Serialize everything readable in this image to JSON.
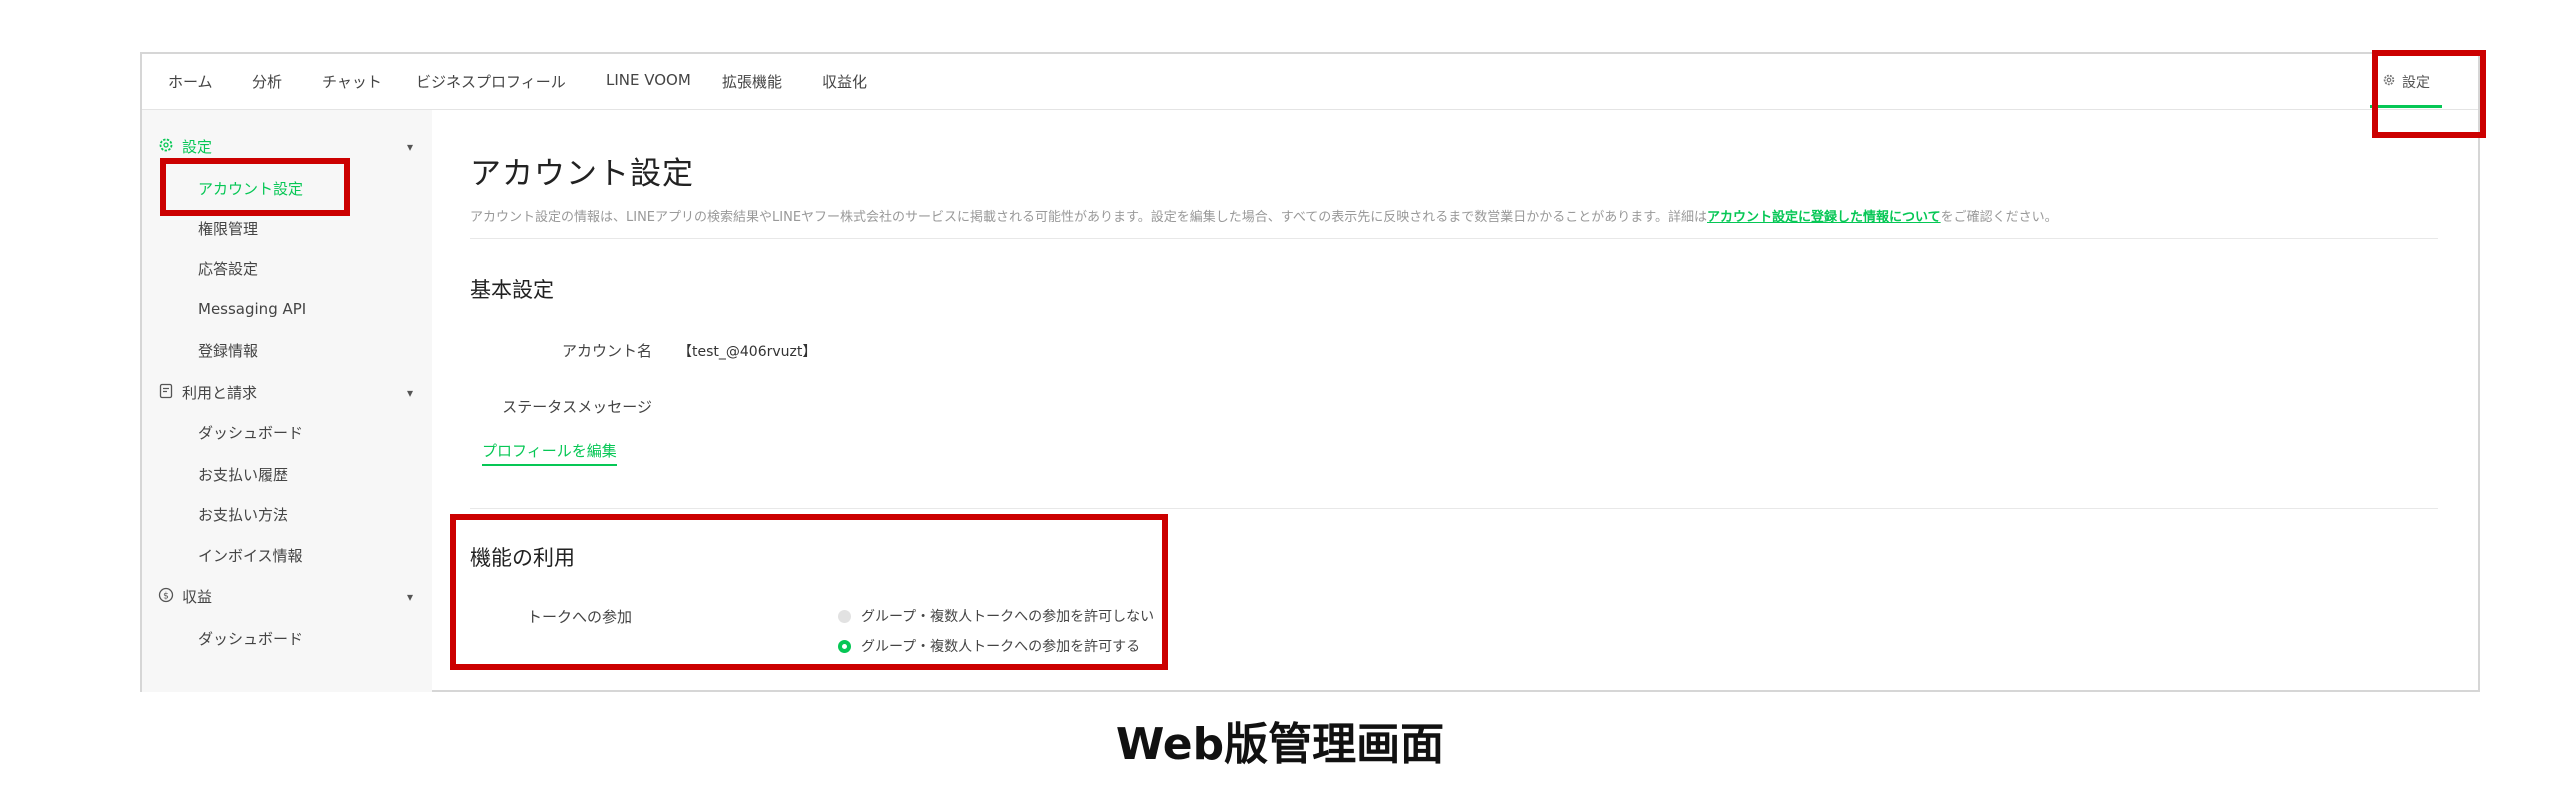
{
  "nav": {
    "items": [
      "ホーム",
      "分析",
      "チャット",
      "ビジネスプロフィール",
      "LINE VOOM",
      "拡張機能",
      "収益化"
    ],
    "settings_label": "設定",
    "settings_icon": "gear-icon"
  },
  "sidebar": {
    "groups": [
      {
        "label": "設定",
        "icon": "gear-icon",
        "items": [
          "アカウント設定",
          "権限管理",
          "応答設定",
          "Messaging API",
          "登録情報"
        ]
      },
      {
        "label": "利用と請求",
        "icon": "document-icon",
        "items": [
          "ダッシュボード",
          "お支払い履歴",
          "お支払い方法",
          "インボイス情報"
        ]
      },
      {
        "label": "収益",
        "icon": "coin-icon",
        "items": [
          "ダッシュボード"
        ]
      }
    ],
    "active_item": "アカウント設定"
  },
  "main": {
    "title": "アカウント設定",
    "notice_prefix": "アカウント設定の情報は、LINEアプリの検索結果やLINEヤフー株式会社のサービスに掲載される可能性があります。設定を編集した場合、すべての表示先に反映されるまで数営業日かかることがあります。詳細は",
    "notice_link": "アカウント設定に登録した情報について",
    "notice_suffix": "をご確認ください。",
    "basic": {
      "title": "基本設定",
      "account_name_label": "アカウント名",
      "account_name_value": "【test_@406rvuzt】",
      "status_label": "ステータスメッセージ",
      "status_value": "",
      "edit_profile_link": "プロフィールを編集"
    },
    "features": {
      "title": "機能の利用",
      "talk_label": "トークへの参加",
      "options": [
        {
          "label": "グループ・複数人トークへの参加を許可しない",
          "selected": false
        },
        {
          "label": "グループ・複数人トークへの参加を許可する",
          "selected": true
        }
      ]
    }
  },
  "caption": "Web版管理画面",
  "colors": {
    "accent": "#06c755",
    "highlight": "#cc0000"
  }
}
